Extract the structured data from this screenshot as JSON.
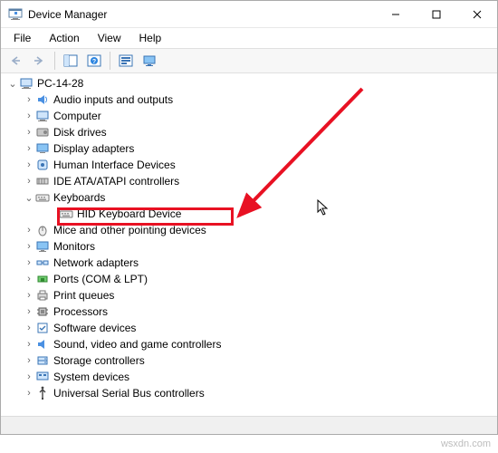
{
  "window": {
    "title": "Device Manager"
  },
  "menu": {
    "file": "File",
    "action": "Action",
    "view": "View",
    "help": "Help"
  },
  "toolbar": {
    "back": "back-icon",
    "forward": "forward-icon",
    "show_hide": "panel-icon",
    "help": "help-icon",
    "properties": "properties-icon",
    "uninstall": "monitor-icon"
  },
  "tree": {
    "root": "PC-14-28",
    "categories": [
      {
        "label": "Audio inputs and outputs",
        "icon": "audio",
        "expanded": false
      },
      {
        "label": "Computer",
        "icon": "computer",
        "expanded": false
      },
      {
        "label": "Disk drives",
        "icon": "disk",
        "expanded": false
      },
      {
        "label": "Display adapters",
        "icon": "display",
        "expanded": false
      },
      {
        "label": "Human Interface Devices",
        "icon": "hid",
        "expanded": false
      },
      {
        "label": "IDE ATA/ATAPI controllers",
        "icon": "ide",
        "expanded": false
      },
      {
        "label": "Keyboards",
        "icon": "keyboard",
        "expanded": true,
        "children": [
          {
            "label": "HID Keyboard Device",
            "icon": "keyboard"
          }
        ]
      },
      {
        "label": "Mice and other pointing devices",
        "icon": "mouse",
        "expanded": false
      },
      {
        "label": "Monitors",
        "icon": "monitor",
        "expanded": false
      },
      {
        "label": "Network adapters",
        "icon": "network",
        "expanded": false
      },
      {
        "label": "Ports (COM & LPT)",
        "icon": "port",
        "expanded": false
      },
      {
        "label": "Print queues",
        "icon": "printer",
        "expanded": false
      },
      {
        "label": "Processors",
        "icon": "cpu",
        "expanded": false
      },
      {
        "label": "Software devices",
        "icon": "software",
        "expanded": false
      },
      {
        "label": "Sound, video and game controllers",
        "icon": "sound",
        "expanded": false
      },
      {
        "label": "Storage controllers",
        "icon": "storage",
        "expanded": false
      },
      {
        "label": "System devices",
        "icon": "system",
        "expanded": false
      },
      {
        "label": "Universal Serial Bus controllers",
        "icon": "usb",
        "expanded": false
      }
    ]
  },
  "watermark": "wsxdn.com",
  "annotations": {
    "highlighted_item": "HID Keyboard Device",
    "arrow_color": "#e81123"
  }
}
